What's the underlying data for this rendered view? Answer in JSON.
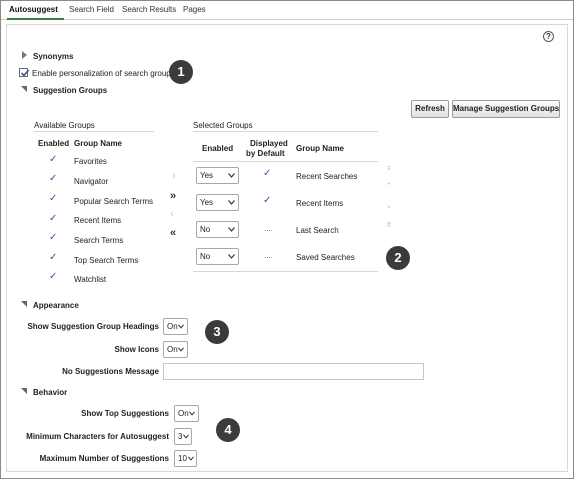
{
  "tabs": [
    {
      "label": "Autosuggest"
    },
    {
      "label": "Search Field"
    },
    {
      "label": "Search Results"
    },
    {
      "label": "Pages"
    }
  ],
  "help_glyph": "?",
  "synonyms": {
    "label": "Synonyms"
  },
  "personalization": {
    "label": "Enable personalization of search groups",
    "checked": true
  },
  "callouts": [
    "1",
    "2",
    "3",
    "4"
  ],
  "suggestion_groups": {
    "title": "Suggestion Groups",
    "refresh_label": "Refresh",
    "manage_label": "Manage Suggestion Groups",
    "available": {
      "title": "Available Groups",
      "col_enabled": "Enabled",
      "col_name": "Group Name",
      "rows": [
        {
          "enabled": "✓",
          "name": "Favorites"
        },
        {
          "enabled": "✓",
          "name": "Navigator"
        },
        {
          "enabled": "✓",
          "name": "Popular Search Terms"
        },
        {
          "enabled": "✓",
          "name": "Recent Items"
        },
        {
          "enabled": "✓",
          "name": "Search Terms"
        },
        {
          "enabled": "✓",
          "name": "Top Search Terms"
        },
        {
          "enabled": "✓",
          "name": "Watchlist"
        }
      ]
    },
    "shuttle": {
      "move": "›",
      "move_all": "»",
      "remove": "‹",
      "remove_all": "«"
    },
    "reorder": {
      "top": "⌅",
      "up": "⌃",
      "down": "⌄",
      "bottom": "⌆"
    },
    "selected": {
      "title": "Selected Groups",
      "col_enabled": "Enabled",
      "col_displayed_1": "Displayed",
      "col_displayed_2": "by Default",
      "col_name": "Group Name",
      "rows": [
        {
          "enabled": "Yes",
          "displayed": "✓",
          "name": "Recent Searches"
        },
        {
          "enabled": "Yes",
          "displayed": "✓",
          "name": "Recent Items"
        },
        {
          "enabled": "No",
          "displayed": "....",
          "name": "Last Search"
        },
        {
          "enabled": "No",
          "displayed": "....",
          "name": "Saved Searches"
        }
      ]
    }
  },
  "appearance": {
    "title": "Appearance",
    "headings_label": "Show Suggestion Group Headings",
    "headings_value": "On",
    "icons_label": "Show Icons",
    "icons_value": "On",
    "no_suggestions_label": "No Suggestions Message",
    "no_suggestions_value": ""
  },
  "behavior": {
    "title": "Behavior",
    "top_label": "Show Top Suggestions",
    "top_value": "On",
    "min_chars_label": "Minimum Characters for Autosuggest",
    "min_chars_value": "3",
    "max_label": "Maximum Number of Suggestions",
    "max_value": "10"
  },
  "colors": {
    "tab_accent": "#3f7d3f",
    "check": "#3b4fa8",
    "badge": "#3b3b3b"
  }
}
